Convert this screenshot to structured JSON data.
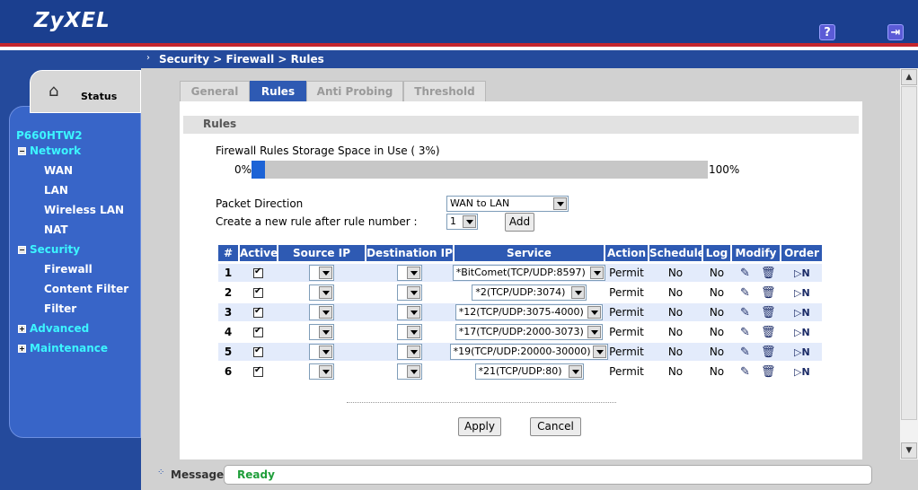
{
  "header": {
    "logo": "ZyXEL",
    "help_icon": "question-icon",
    "logout_icon": "logout-icon",
    "brand_color": "#1b3f8f",
    "accent_color": "#c3262e"
  },
  "breadcrumb": "Security > Firewall > Rules",
  "sidebar": {
    "status_label": "Status",
    "device": "P660HTW2",
    "sections": [
      {
        "label": "Network",
        "expander": "−",
        "items": [
          "WAN",
          "LAN",
          "Wireless LAN",
          "NAT"
        ]
      },
      {
        "label": "Security",
        "expander": "−",
        "items": [
          "Firewall",
          "Content Filter",
          "Filter"
        ]
      },
      {
        "label": "Advanced",
        "expander": "+"
      },
      {
        "label": "Maintenance",
        "expander": "+"
      }
    ]
  },
  "tabs": [
    "General",
    "Rules",
    "Anti Probing",
    "Threshold"
  ],
  "active_tab": "Rules",
  "panel": {
    "title": "Rules",
    "storage_label": "Firewall Rules Storage Space in Use  ( 3%)",
    "storage_percent": 3,
    "storage_min": "0%",
    "storage_max": "100%",
    "packet_direction_label": "Packet Direction",
    "packet_direction_value": "WAN to LAN",
    "new_rule_label": "Create a new rule after rule number :",
    "new_rule_value": "1",
    "add_button": "Add"
  },
  "table": {
    "headers": [
      "#",
      "Active",
      "Source IP",
      "Destination IP",
      "Service",
      "Action",
      "Schedule",
      "Log",
      "Modify",
      "Order"
    ],
    "rows": [
      {
        "num": "1",
        "service": "*BitComet(TCP/UDP:8597)",
        "action": "Permit",
        "schedule": "No",
        "log": "No"
      },
      {
        "num": "2",
        "service": "*2(TCP/UDP:3074)",
        "action": "Permit",
        "schedule": "No",
        "log": "No"
      },
      {
        "num": "3",
        "service": "*12(TCP/UDP:3075-4000)",
        "action": "Permit",
        "schedule": "No",
        "log": "No"
      },
      {
        "num": "4",
        "service": "*17(TCP/UDP:2000-3073)",
        "action": "Permit",
        "schedule": "No",
        "log": "No"
      },
      {
        "num": "5",
        "service": "*19(TCP/UDP:20000-30000)",
        "action": "Permit",
        "schedule": "No",
        "log": "No"
      },
      {
        "num": "6",
        "service": "*21(TCP/UDP:80)",
        "action": "Permit",
        "schedule": "No",
        "log": "No"
      }
    ]
  },
  "apply_button": "Apply",
  "cancel_button": "Cancel",
  "statusbar": {
    "label": "Message",
    "text": "Ready"
  }
}
